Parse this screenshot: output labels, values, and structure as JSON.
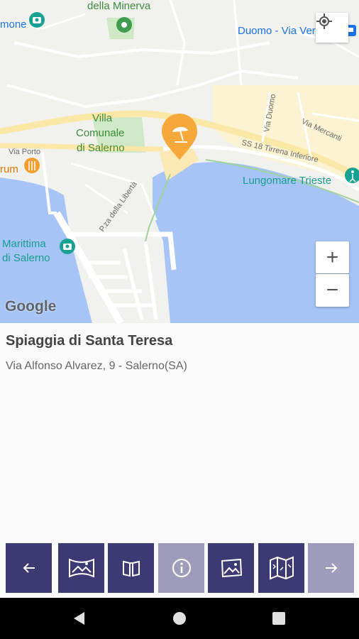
{
  "map": {
    "labels": {
      "minerva": "della Minerva",
      "mone": "mone",
      "duomo_via": "Duomo - Via Verdi",
      "villa1": "Villa",
      "villa2": "Comunale",
      "villa3": "di Salerno",
      "via_porto": "Via Porto",
      "rum": "rum",
      "ss18": "SS 18 Tirrena Inferiore",
      "via_duomo": "Via Duomo",
      "via_mercanti": "Via Mercanti",
      "lungomare": "Lungomare Trieste",
      "pza_liberta": "P.za della Libertà",
      "marittima1": "Marittima",
      "marittima2": "di Salerno",
      "google": "Google"
    },
    "zoom_in_label": "+",
    "zoom_out_label": "−"
  },
  "place": {
    "title": "Spiaggia di Santa Teresa",
    "address": "Via Alfonso Alvarez, 9 - Salerno(SA)"
  },
  "toolbar": {
    "buttons": [
      {
        "name": "back-button",
        "icon": "arrow-left-icon",
        "enabled": true
      },
      {
        "name": "panorama-button",
        "icon": "panorama-icon",
        "enabled": true
      },
      {
        "name": "book-button",
        "icon": "book-icon",
        "enabled": true
      },
      {
        "name": "info-button",
        "icon": "info-icon",
        "enabled": false
      },
      {
        "name": "gallery-button",
        "icon": "image-icon",
        "enabled": true
      },
      {
        "name": "map-button",
        "icon": "map-icon",
        "enabled": true
      },
      {
        "name": "forward-button",
        "icon": "arrow-right-icon",
        "enabled": false
      }
    ]
  },
  "colors": {
    "toolbar_active": "#3d3a73",
    "toolbar_disabled": "#9e9bbb",
    "sea": "#a6c4f6",
    "marker": "#f6a83b"
  }
}
